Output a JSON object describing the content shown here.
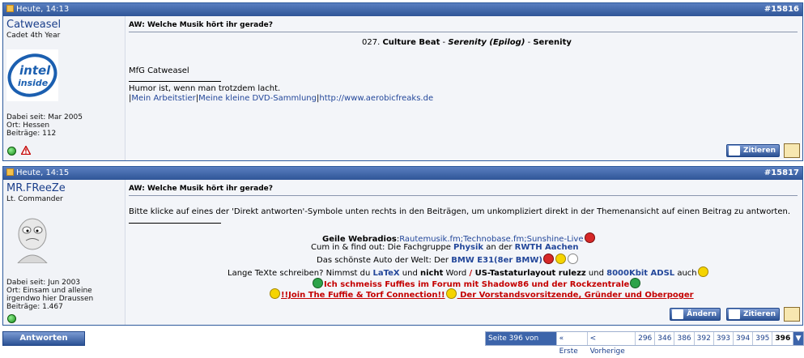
{
  "posts": [
    {
      "date": "Heute, 14:13",
      "number": "#15816",
      "user": {
        "name": "Catweasel",
        "title": "Cadet 4th Year",
        "avatar_text": "intel inside",
        "joined": "Dabei seit: Mar 2005",
        "location": "Ort: Hessen",
        "posts": "Beiträge: 112"
      },
      "subject": "AW: Welche Musik hört ihr gerade?",
      "body": {
        "track_num": "027.",
        "artist": "Culture Beat",
        "album": "Serenity (Epilog)",
        "dash": " - ",
        "track": "Serenity",
        "greeting": "MfG Catweasel",
        "sig_quote": "Humor ist, wenn man trotzdem lacht.",
        "sig_sep": "|",
        "sig_link1": "Mein Arbeitstier",
        "sig_link2": "Meine kleine DVD-Sammlung",
        "sig_link3": "http://www.aerobicfreaks.de"
      },
      "buttons": {
        "quote": "Zitieren"
      }
    },
    {
      "date": "Heute, 14:15",
      "number": "#15817",
      "user": {
        "name": "MR.FReeZe",
        "title": "Lt. Commander",
        "joined": "Dabei seit: Jun 2003",
        "location_1": "Ort: Einsam und alleine",
        "location_2": "irgendwo hier Draussen",
        "posts": "Beiträge: 1.467"
      },
      "subject": "AW: Welche Musik hört ihr gerade?",
      "body": {
        "text": "Bitte klicke auf eines der 'Direkt antworten'-Symbole unten rechts in den Beiträgen, um unkompliziert direkt in der Themenansicht auf einen Beitrag zu antworten.",
        "sig1_label": "Geile Webradios",
        "sig1_colon": ":",
        "sig1_links": "Rautemusik.fm;Technobase.fm;Sunshine-Live",
        "sig2_a": "Cum in & find out: Die Fachgruppe ",
        "sig2_b": "Physik",
        "sig2_c": " an der ",
        "sig2_d": "RWTH Aachen",
        "sig3_a": "Das schönste Auto der Welt: Der ",
        "sig3_b": "BMW E31(8er BMW)",
        "sig4_a": "Lange TeXte schreiben? Nimmst du ",
        "sig4_b": "LaTeX",
        "sig4_c": " und ",
        "sig4_d": "nicht",
        "sig4_e": " Word ",
        "sig4_f": "/",
        "sig4_g": " US-Tastaturlayout rulezz",
        "sig4_h": " und ",
        "sig4_i": "8000Kbit ADSL",
        "sig4_j": " auch",
        "sig5": "Ich schmeiss Fuffies im Forum mit Shadow86 und der Rockzentrale",
        "sig6_a": "!!Join The Fuffie & Torf Connection!!",
        "sig6_b": " Der Vorstandsvorsitzende, Gründer und Oberpoger"
      },
      "buttons": {
        "edit": "Ändern",
        "quote": "Zitieren"
      }
    }
  ],
  "footer": {
    "reply": "Antworten",
    "page_info": "Seite 396 von 396",
    "first": "« Erste",
    "prev": "< Vorherige",
    "pages": [
      "296",
      "346",
      "386",
      "392",
      "393",
      "394",
      "395",
      "396"
    ],
    "current": "396"
  }
}
